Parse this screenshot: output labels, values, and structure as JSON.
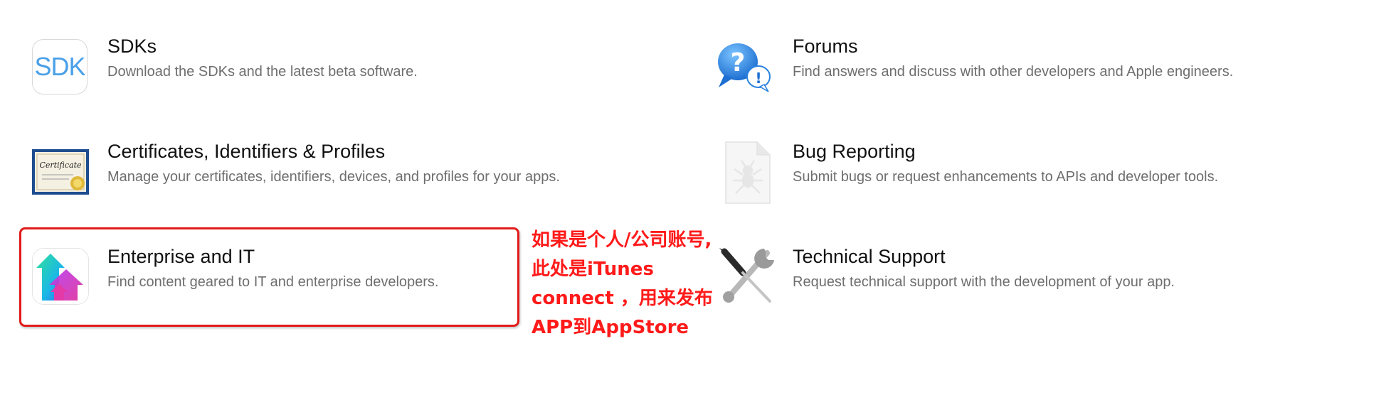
{
  "resources": [
    {
      "id": "sdks",
      "title": "SDKs",
      "description": "Download the SDKs and the latest beta software.",
      "icon": "sdk-icon",
      "icon_text": "SDK"
    },
    {
      "id": "forums",
      "title": "Forums",
      "description": "Find answers and discuss with other developers and Apple engineers.",
      "icon": "forums-icon"
    },
    {
      "id": "certificates",
      "title": "Certificates, Identifiers & Profiles",
      "description": "Manage your certificates, identifiers, devices, and profiles for your apps.",
      "icon": "certificate-icon",
      "icon_text": "Certificate"
    },
    {
      "id": "bug-reporting",
      "title": "Bug Reporting",
      "description": "Submit bugs or request enhancements to APIs and developer tools.",
      "icon": "bug-icon"
    },
    {
      "id": "enterprise",
      "title": "Enterprise and IT",
      "description": "Find content geared to IT and enterprise developers.",
      "icon": "enterprise-icon"
    },
    {
      "id": "technical-support",
      "title": "Technical Support",
      "description": "Request technical support with the development of your app.",
      "icon": "tools-icon"
    }
  ],
  "annotation": {
    "lines": [
      "如果是个人/公司账号,",
      "此处是iTunes",
      "connect ，用来发布",
      "APP到AppStore"
    ],
    "color": "#ff1a1a"
  },
  "colors": {
    "highlight_border": "#e21a1a",
    "title": "#111111",
    "description": "#6e6e6e",
    "sdk_blue": "#4aa0e8"
  }
}
